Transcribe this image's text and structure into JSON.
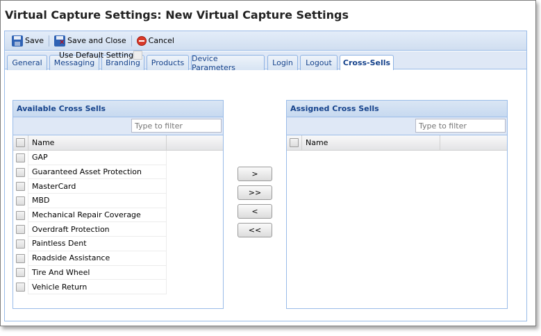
{
  "window": {
    "title": "Virtual Capture Settings: New Virtual Capture Settings"
  },
  "toolbar": {
    "save_label": "Save",
    "save_close_label": "Save and Close",
    "cancel_label": "Cancel"
  },
  "tabs": [
    {
      "label": "General"
    },
    {
      "label": "Messaging"
    },
    {
      "label": "Branding"
    },
    {
      "label": "Products"
    },
    {
      "label": "Device Parameters"
    },
    {
      "label": "Login"
    },
    {
      "label": "Logout"
    },
    {
      "label": "Cross-Sells",
      "active": true
    }
  ],
  "use_default": {
    "label": "Use Default Settings:",
    "checked": false,
    "disabled": true
  },
  "available": {
    "title": "Available Cross Sells",
    "filter_placeholder": "Type to filter",
    "column_name": "Name",
    "items": [
      "GAP",
      "Guaranteed Asset Protection",
      "MasterCard",
      "MBD",
      "Mechanical Repair Coverage",
      "Overdraft Protection",
      "Paintless Dent",
      "Roadside Assistance",
      "Tire And Wheel",
      "Vehicle Return"
    ]
  },
  "assigned": {
    "title": "Assigned Cross Sells",
    "filter_placeholder": "Type to filter",
    "column_name": "Name",
    "items": []
  },
  "move_buttons": {
    "add_selected": ">",
    "add_all": ">>",
    "remove_selected": "<",
    "remove_all": "<<"
  }
}
